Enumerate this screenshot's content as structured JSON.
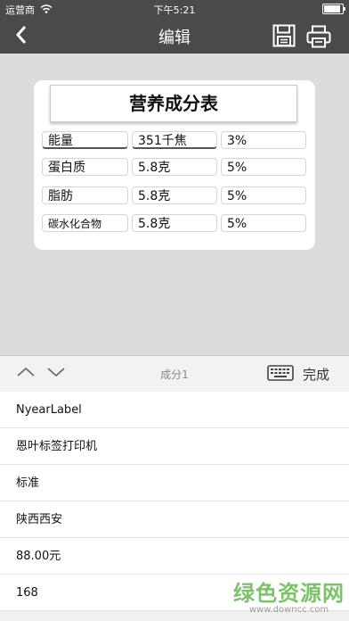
{
  "status": {
    "carrier": "运营商",
    "time": "下午5:21",
    "battery_level": 0.9
  },
  "nav": {
    "back_icon": "chevron-left",
    "title": "编辑",
    "save_icon": "save-disk",
    "print_icon": "printer"
  },
  "label": {
    "title": "营养成分表",
    "rows": [
      {
        "name": "能量",
        "amount": "351千焦",
        "percent": "3%"
      },
      {
        "name": "蛋白质",
        "amount": "5.8克",
        "percent": "5%"
      },
      {
        "name": "脂肪",
        "amount": "5.8克",
        "percent": "5%"
      },
      {
        "name": "碳水化合物",
        "amount": "5.8克",
        "percent": "5%"
      }
    ]
  },
  "toolbar": {
    "field_name": "成分1",
    "done_label": "完成"
  },
  "fields": [
    "NyearLabel",
    "恩叶标签打印机",
    "标准",
    "陕西西安",
    "88.00元",
    "168"
  ],
  "watermark": {
    "main": "绿色资源网",
    "sub": "www.downcc.com"
  }
}
